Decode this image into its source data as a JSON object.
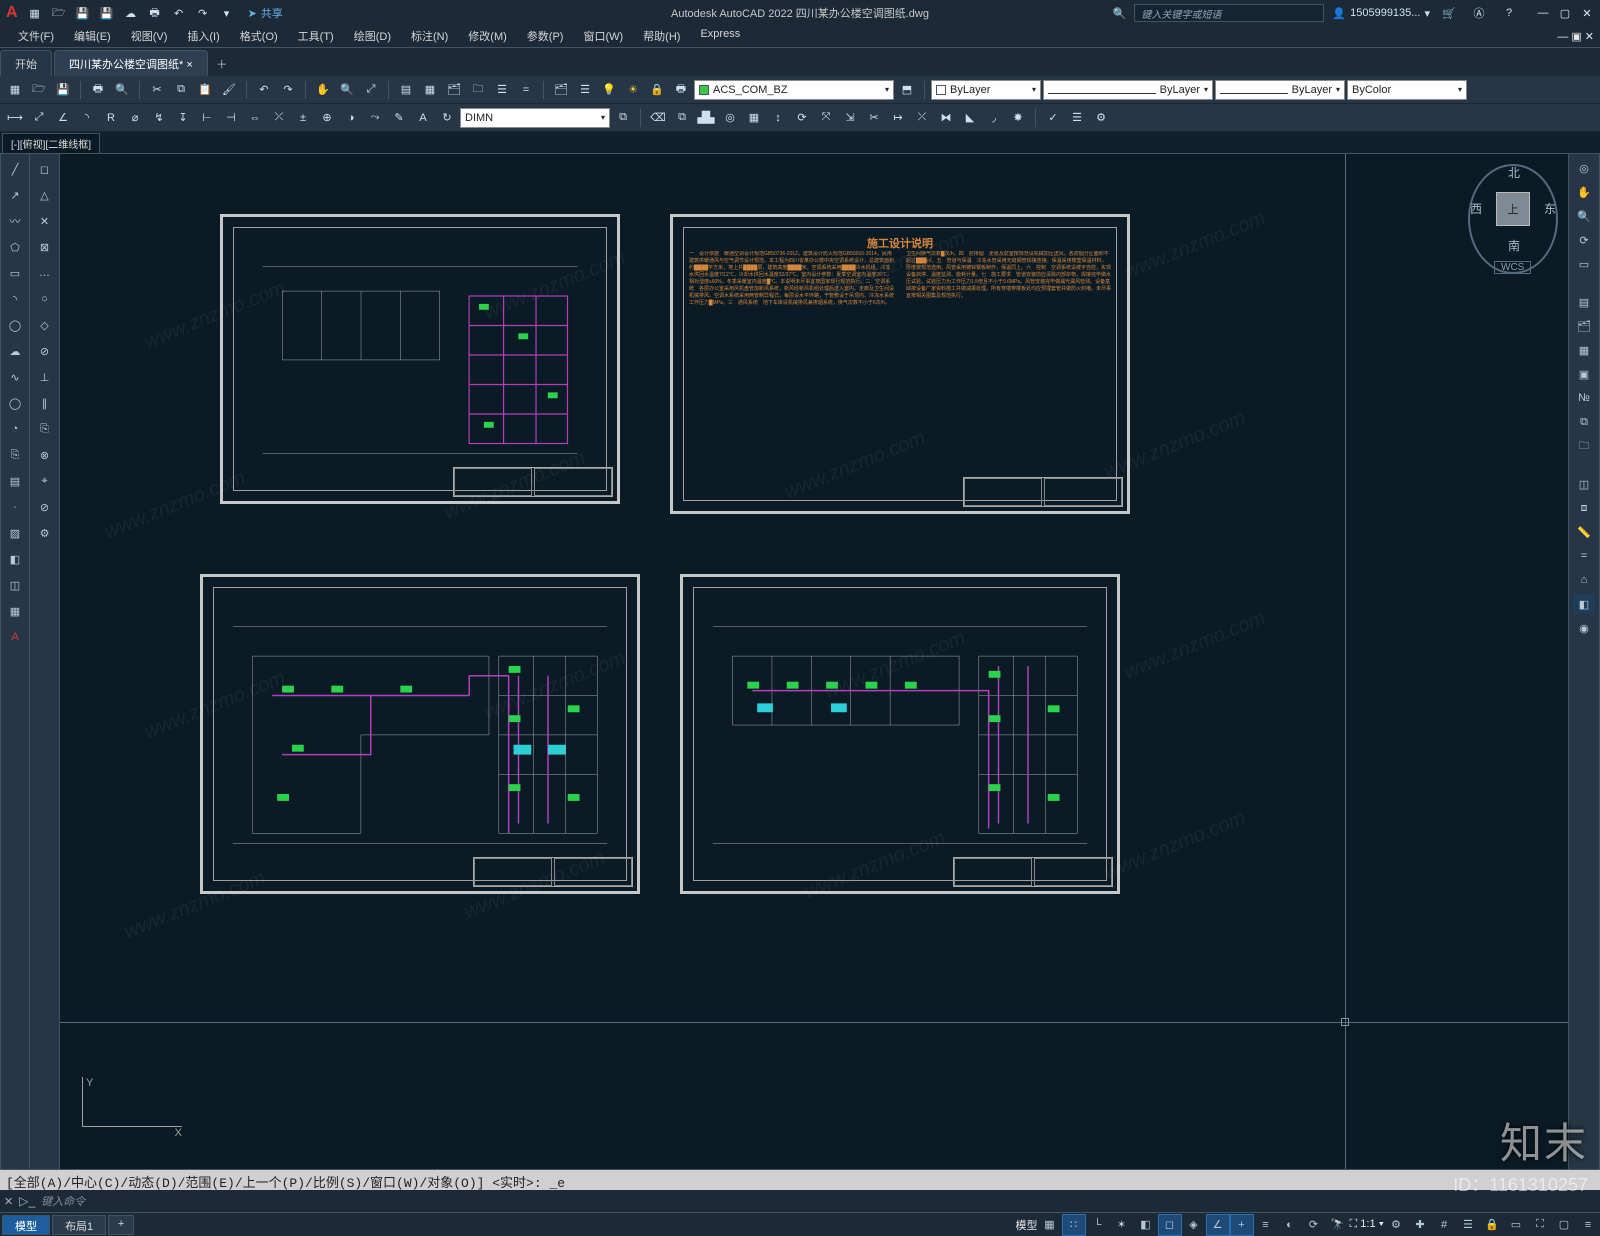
{
  "app": {
    "title": "Autodesk AutoCAD 2022   四川某办公楼空调图纸.dwg"
  },
  "share": "共享",
  "search_placeholder": "键入关键字或短语",
  "user": "1505999135...",
  "menus": [
    "文件(F)",
    "编辑(E)",
    "视图(V)",
    "插入(I)",
    "格式(O)",
    "工具(T)",
    "绘图(D)",
    "标注(N)",
    "修改(M)",
    "参数(P)",
    "窗口(W)",
    "帮助(H)",
    "Express"
  ],
  "main_tabs": {
    "start": "开始",
    "current": "四川某办公楼空调图纸* ×"
  },
  "doc_tab": "[-][俯视][二维线框]",
  "layer_name": "ACS_COM_BZ",
  "prop_layer": "ByLayer",
  "prop_ltype": "ByLayer",
  "prop_lweight": "ByLayer",
  "prop_color": "ByColor",
  "dimstyle": "DIMN",
  "viewcube": {
    "face": "上",
    "n": "北",
    "s": "南",
    "e": "东",
    "w": "西",
    "wcs": "WCS"
  },
  "ucs": {
    "x": "X",
    "y": "Y"
  },
  "cmd_history": "[全部(A)/中心(C)/动态(D)/范围(E)/上一个(P)/比例(S)/窗口(W)/对象(O)] <实时>: _e",
  "cmd_hint": "键入命令",
  "layout_tabs": {
    "model": "模型",
    "l1": "布局1",
    "add": "+"
  },
  "status": {
    "modelpill": "模型",
    "grid": "#",
    "scale": "1:1",
    "cog": "⚙"
  },
  "watermark_site": "www.znzmo.com",
  "watermark_big": "知末",
  "watermark_id": "ID：1161310257",
  "sheet_text_title": "施工设计说明"
}
